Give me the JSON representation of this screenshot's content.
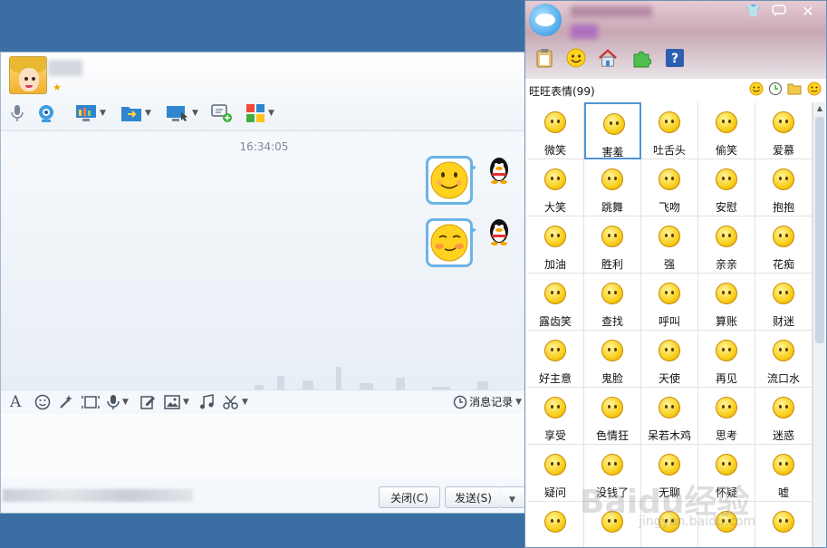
{
  "chat": {
    "timestamp": "16:34:05",
    "history_label": "消息记录",
    "close_label": "关闭(C)",
    "send_label": "发送(S)"
  },
  "panel": {
    "title": "旺旺表情(99)",
    "emoticons": [
      "微笑",
      "害羞",
      "吐舌头",
      "偷笑",
      "爱慕",
      "大笑",
      "跳舞",
      "飞吻",
      "安慰",
      "抱抱",
      "加油",
      "胜利",
      "强",
      "亲亲",
      "花痴",
      "露齿笑",
      "查找",
      "呼叫",
      "算账",
      "财迷",
      "好主意",
      "鬼脸",
      "天使",
      "再见",
      "流口水",
      "享受",
      "色情狂",
      "呆若木鸡",
      "思考",
      "迷惑",
      "疑问",
      "没钱了",
      "无聊",
      "怀疑",
      "嘘",
      "",
      "",
      "",
      "",
      ""
    ],
    "selected_index": 1
  },
  "watermark": "Baidu经验",
  "watermark_sub": "jingyan.baidu.com",
  "colors": {
    "desktop": "#3b6fa3",
    "bubble_border": "#6cb4e8",
    "emoticon": "#f9cf1c",
    "selection": "#4f94d4"
  }
}
